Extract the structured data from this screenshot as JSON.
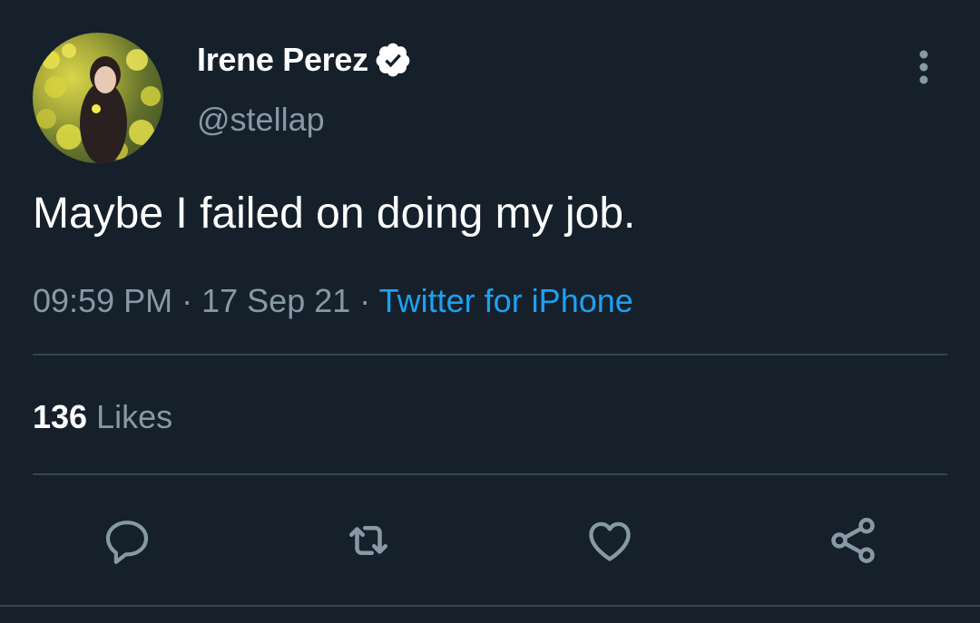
{
  "author": {
    "display_name": "Irene Perez",
    "handle": "@stellap",
    "verified": true,
    "avatar_icon": "profile-photo"
  },
  "tweet": {
    "text": "Maybe I failed on doing my job.",
    "time": "09:59 PM",
    "date": "17 Sep 21",
    "separator": "·",
    "source": "Twitter for iPhone"
  },
  "stats": {
    "likes_count": "136",
    "likes_label": "Likes"
  },
  "actions": [
    {
      "name": "reply",
      "icon": "comment-icon"
    },
    {
      "name": "retweet",
      "icon": "retweet-icon"
    },
    {
      "name": "like",
      "icon": "heart-icon"
    },
    {
      "name": "share",
      "icon": "share-icon"
    }
  ],
  "colors": {
    "background": "#15202b",
    "primary_text": "#ffffff",
    "secondary_text": "#8899a6",
    "link": "#1da1f2",
    "divider": "#38444d"
  }
}
